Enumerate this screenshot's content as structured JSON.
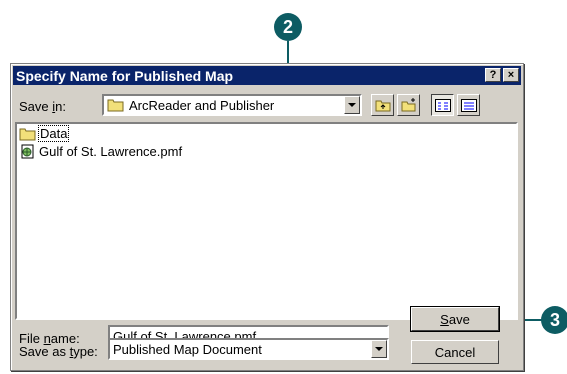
{
  "callouts": {
    "top": "2",
    "right": "3"
  },
  "dialog": {
    "title": "Specify Name for Published Map",
    "help_button": "?",
    "close_button": "×"
  },
  "save_in": {
    "label_pre": "Save ",
    "label_underline": "i",
    "label_post": "n:",
    "value": "ArcReader and Publisher"
  },
  "toolbar": {
    "icons": [
      "up-folder-icon",
      "new-folder-icon",
      "list-view-icon",
      "details-view-icon"
    ]
  },
  "files": [
    {
      "name": "Data",
      "icon": "folder-icon"
    },
    {
      "name": "Gulf of St. Lawrence.pmf",
      "icon": "map-document-icon"
    }
  ],
  "file_name": {
    "label_pre": "File ",
    "label_underline": "n",
    "label_post": "ame:",
    "value": "Gulf of St. Lawrence.pmf"
  },
  "save_as_type": {
    "label_pre": "Save as ",
    "label_underline": "t",
    "label_post": "ype:",
    "value": "Published Map Document"
  },
  "buttons": {
    "save_underline": "S",
    "save_rest": "ave",
    "cancel": "Cancel"
  },
  "colors": {
    "accent": "#0d5c63",
    "titlebar": "#0a246a",
    "face": "#d4d0c8"
  }
}
